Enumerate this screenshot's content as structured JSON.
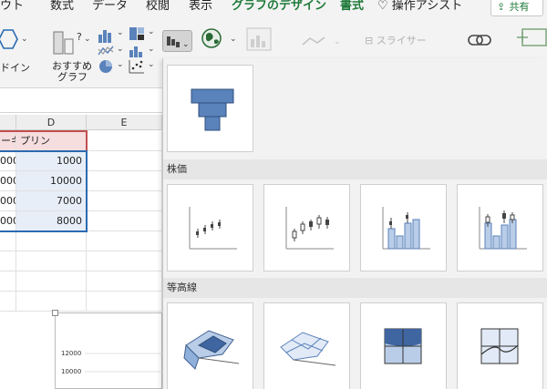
{
  "ribbon": {
    "tabs": [
      {
        "label": "ウト",
        "active": false
      },
      {
        "label": "数式",
        "active": false
      },
      {
        "label": "データ",
        "active": false
      },
      {
        "label": "校閲",
        "active": false
      },
      {
        "label": "表示",
        "active": false
      },
      {
        "label": "グラフのデザイン",
        "active": true
      },
      {
        "label": "書式",
        "active": true
      }
    ],
    "tell_me": "操作アシスト",
    "share": "共有",
    "addin_label": "ドイン",
    "recommended_label_1": "おすすめ",
    "recommended_label_2": "グラフ",
    "slicer_label": "スライサー"
  },
  "sheet": {
    "col_headers": [
      "",
      "D",
      "E"
    ],
    "rows": [
      [
        "ーキ",
        "プリン"
      ],
      [
        "000",
        "1000"
      ],
      [
        "000",
        "10000"
      ],
      [
        "000",
        "7000"
      ],
      [
        "000",
        "8000"
      ]
    ],
    "chart_ticks": [
      "12000",
      "10000"
    ]
  },
  "gallery": {
    "sections": [
      {
        "title": "",
        "items": [
          "funnel"
        ]
      },
      {
        "title": "株価",
        "items": [
          "stock-hlc",
          "stock-ohlc",
          "stock-vhlc",
          "stock-vohlc"
        ]
      },
      {
        "title": "等高線",
        "items": [
          "surface-3d",
          "wireframe-3d",
          "contour",
          "wireframe-contour"
        ]
      }
    ]
  },
  "colors": {
    "accent_green": "#1e7a3a",
    "selection_blue": "#2b6ab1",
    "chart_blue": "#5a82bb"
  }
}
